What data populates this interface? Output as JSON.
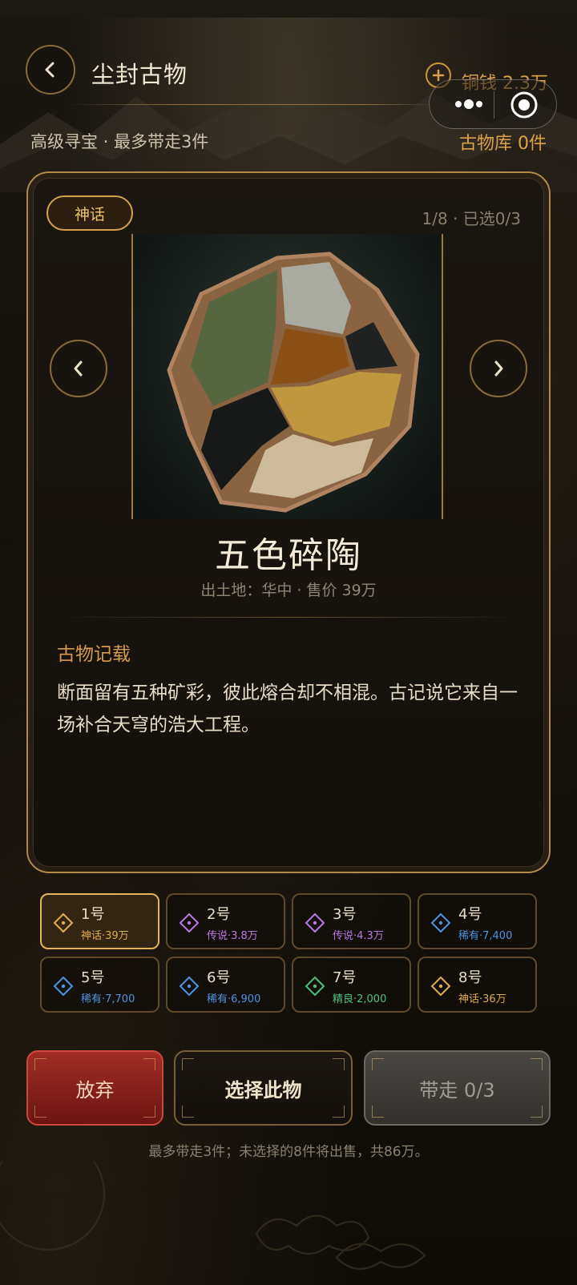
{
  "header": {
    "title": "尘封古物",
    "subtitle": "高级寻宝 · 最多带走3件",
    "coins_label": "铜钱 2.3万",
    "vault_label": "古物库 0件"
  },
  "card": {
    "rarity_badge": "神话",
    "counter": "1/8 · 已选0/3",
    "item_name": "五色碎陶",
    "item_meta": "出土地：华中 · 售价 39万",
    "record_title": "古物记载",
    "record_text": "断面留有五种矿彩，彼此熔合却不相混。古记说它来自一场补合天穹的浩大工程。"
  },
  "slots": [
    {
      "num": "1号",
      "sub": "神话·39万",
      "color": "#e0ad4f",
      "active": true
    },
    {
      "num": "2号",
      "sub": "传说·3.8万",
      "color": "#b77be0",
      "active": false
    },
    {
      "num": "3号",
      "sub": "传说·4.3万",
      "color": "#b77be0",
      "active": false
    },
    {
      "num": "4号",
      "sub": "稀有·7,400",
      "color": "#4e93e0",
      "active": false
    },
    {
      "num": "5号",
      "sub": "稀有·7,700",
      "color": "#4e93e0",
      "active": false
    },
    {
      "num": "6号",
      "sub": "稀有·6,900",
      "color": "#4e93e0",
      "active": false
    },
    {
      "num": "7号",
      "sub": "精良·2,000",
      "color": "#4fc07a",
      "active": false
    },
    {
      "num": "8号",
      "sub": "神话·36万",
      "color": "#e0ad4f",
      "active": false
    }
  ],
  "actions": {
    "abandon_label": "放弃",
    "select_label": "选择此物",
    "take_label": "带走 0/3"
  },
  "footer_note": "最多带走3件；未选择的8件将出售，共86万。",
  "icons": [
    "back-arrow-icon",
    "plus-icon",
    "more-icon",
    "target-close-icon",
    "chevron-left-icon",
    "chevron-right-icon",
    "diamond-icon"
  ],
  "colors": {
    "gold": "#d9a24a",
    "abandon_red": "#a12c22",
    "legend_purple": "#b77be0",
    "rare_blue": "#4e93e0",
    "fine_green": "#4fc07a"
  }
}
